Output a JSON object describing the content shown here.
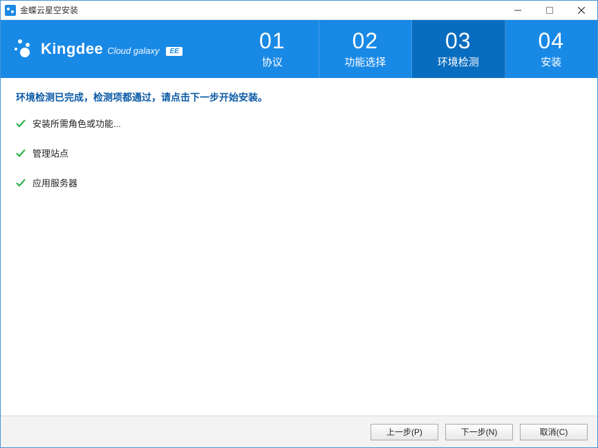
{
  "window": {
    "title": "金蝶云星空安装"
  },
  "logo": {
    "brand": "Kingdee",
    "sub": "Cloud galaxy",
    "badge": "EE"
  },
  "steps": [
    {
      "num": "01",
      "label": "协议",
      "active": false
    },
    {
      "num": "02",
      "label": "功能选择",
      "active": false
    },
    {
      "num": "03",
      "label": "环境检测",
      "active": true
    },
    {
      "num": "04",
      "label": "安装",
      "active": false
    }
  ],
  "status_heading": "环境检测已完成，检测项都通过，请点击下一步开始安装。",
  "check_items": [
    {
      "label": "安装所需角色或功能..."
    },
    {
      "label": "管理站点"
    },
    {
      "label": "应用服务器"
    }
  ],
  "buttons": {
    "prev": "上一步(P)",
    "next": "下一步(N)",
    "cancel": "取消(C)"
  }
}
